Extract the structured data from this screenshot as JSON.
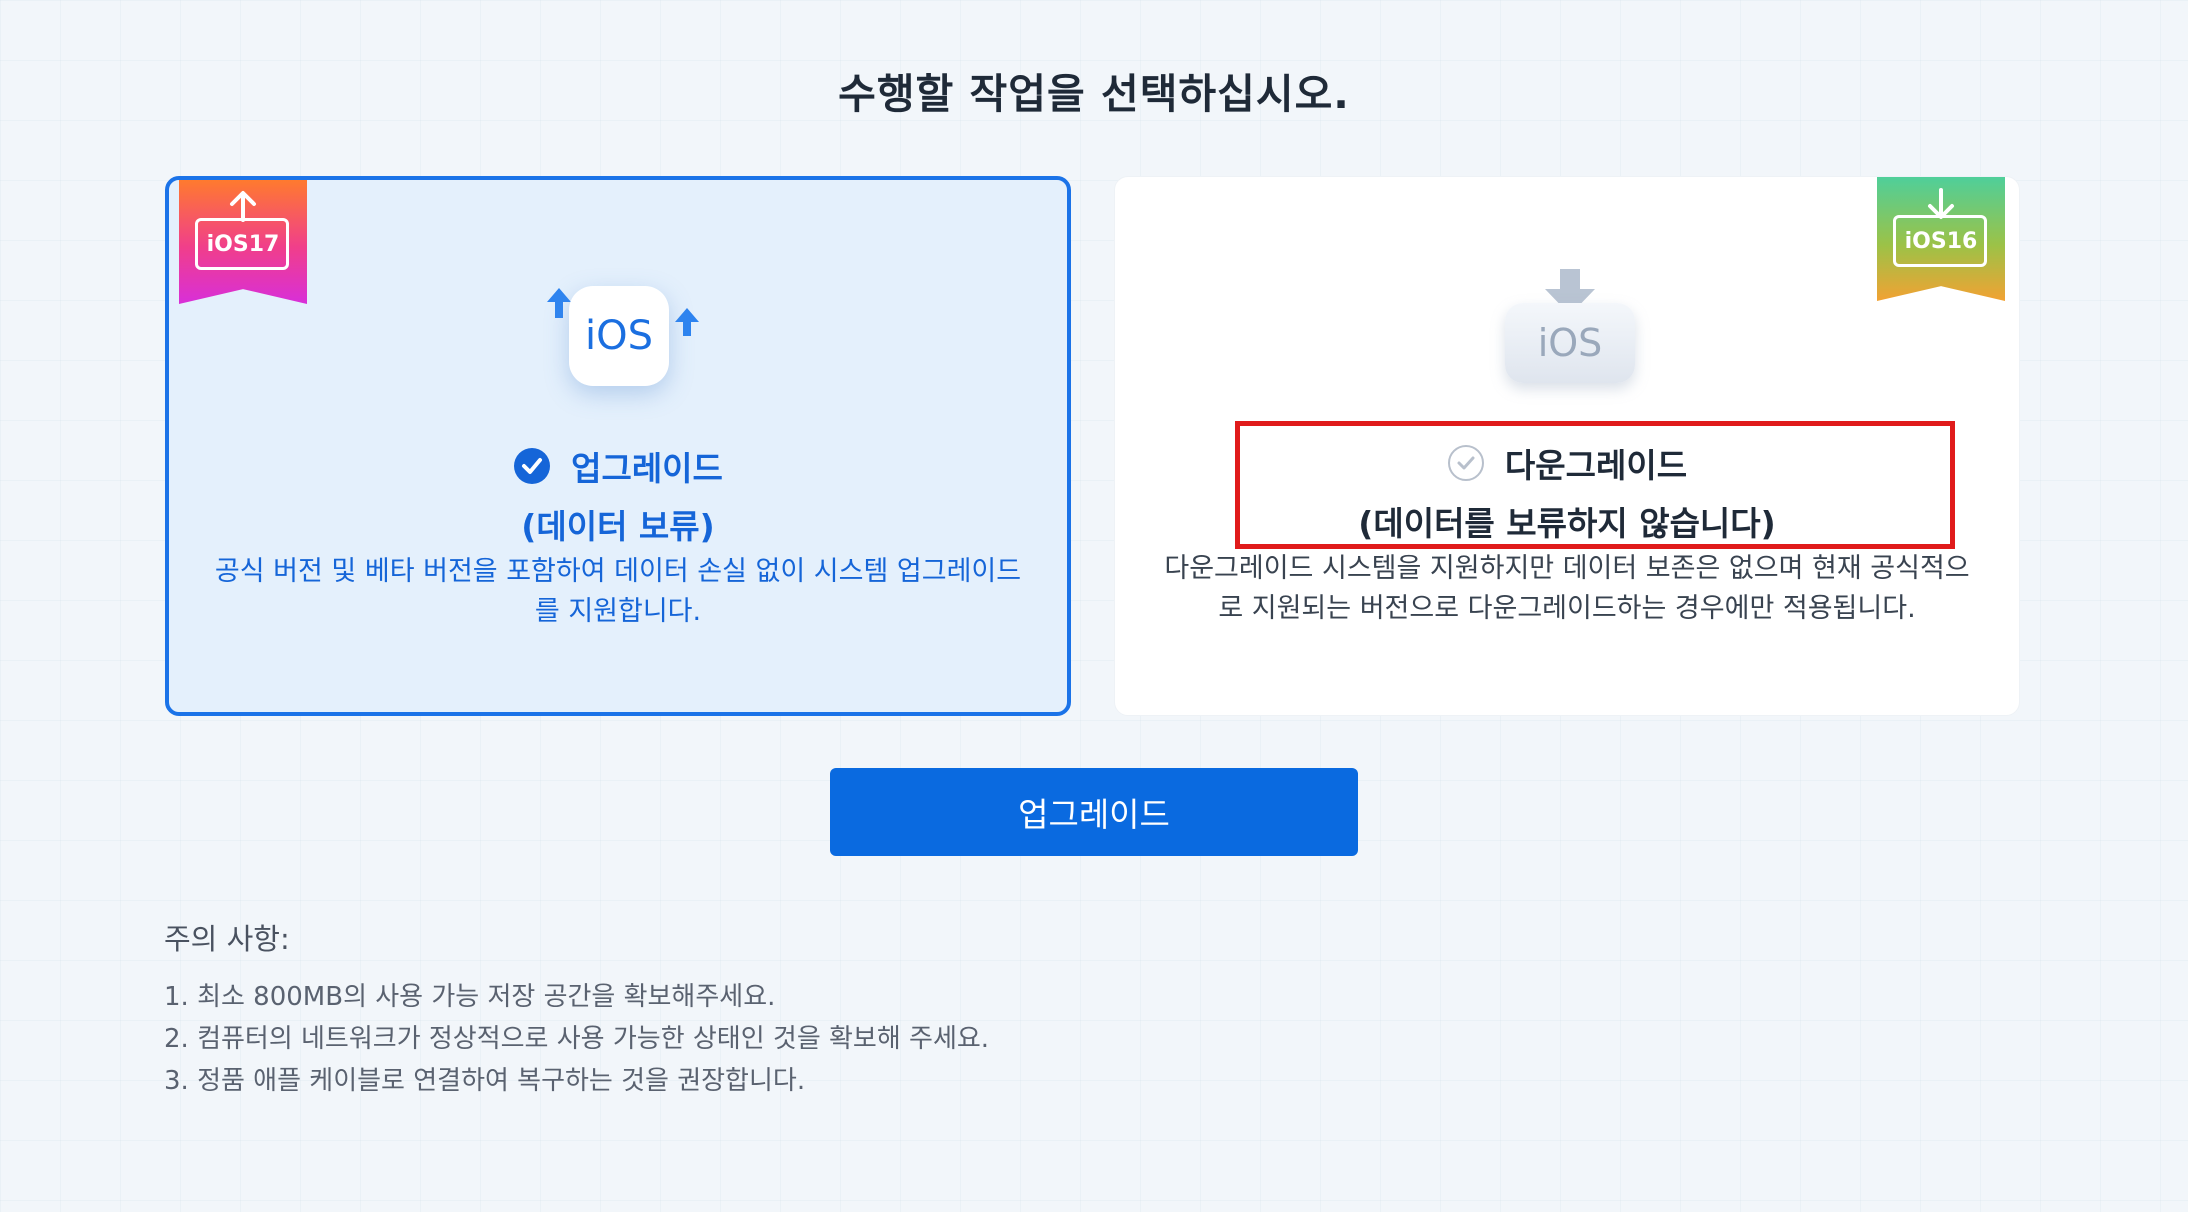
{
  "title": "수행할 작업을 선택하십시오.",
  "upgrade": {
    "badge": "iOS17",
    "icon_text": "iOS",
    "heading": "업그레이드",
    "subheading": "(데이터 보류)",
    "description": "공식 버전 및 베타 버전을 포함하여 데이터 손실 없이 시스템 업그레이드를 지원합니다.",
    "selected": true,
    "icon": "check-circle-filled-icon"
  },
  "downgrade": {
    "badge": "iOS16",
    "icon_text": "iOS",
    "heading": "다운그레이드",
    "subheading": "(데이터를 보류하지 않습니다)",
    "description": "다운그레이드 시스템을 지원하지만 데이터 보존은 없으며 현재 공식적으로 지원되는 버전으로 다운그레이드하는 경우에만 적용됩니다.",
    "selected": false,
    "icon": "check-circle-outline-icon"
  },
  "button_label": "업그레이드",
  "notes": {
    "title": "주의 사항:",
    "items": [
      "1.  최소 800MB의 사용 가능 저장 공간을 확보해주세요.",
      "2.  컴퓨터의 네트워크가 정상적으로 사용 가능한 상태인 것을 확보해 주세요.",
      "3.  정품 애플 케이블로 연결하여 복구하는 것을 권장합니다."
    ]
  },
  "colors": {
    "accent": "#1b73e8",
    "highlight": "#e01b1b"
  }
}
